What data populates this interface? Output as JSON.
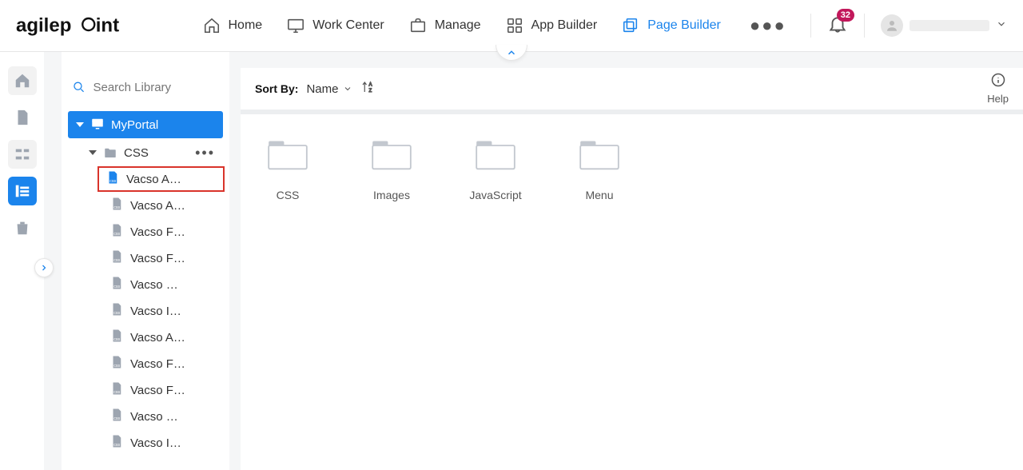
{
  "header": {
    "nav": {
      "home": "Home",
      "work_center": "Work Center",
      "manage": "Manage",
      "app_builder": "App Builder",
      "page_builder": "Page Builder"
    },
    "notification_count": "32"
  },
  "search": {
    "placeholder": "Search Library"
  },
  "tree": {
    "root": "MyPortal",
    "folder": "CSS",
    "files": [
      "Vacso A…",
      "Vacso A…",
      "Vacso F…",
      "Vacso F…",
      "Vacso …",
      "Vacso I…",
      "Vacso A…",
      "Vacso F…",
      "Vacso F…",
      "Vacso …",
      "Vacso I…"
    ]
  },
  "sortbar": {
    "label": "Sort By:",
    "value": "Name",
    "help": "Help"
  },
  "folders": {
    "f0": "CSS",
    "f1": "Images",
    "f2": "JavaScript",
    "f3": "Menu"
  }
}
